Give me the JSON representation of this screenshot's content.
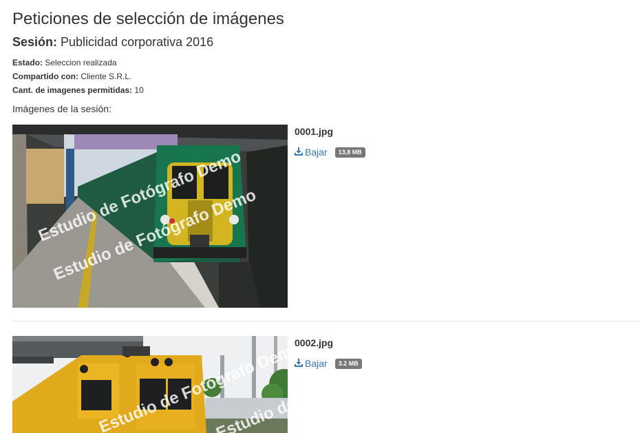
{
  "page": {
    "title": "Peticiones de selección de imágenes"
  },
  "session": {
    "label": "Sesión:",
    "name": "Publicidad corporativa 2016"
  },
  "meta": {
    "status_label": "Estado:",
    "status_value": "Seleccion realizada",
    "shared_label": "Compartido con:",
    "shared_value": "Cliente S.R.L.",
    "count_label": "Cant. de imagenes permitidas:",
    "count_value": "10"
  },
  "images_label": "Imágenes de la sesión:",
  "images": [
    {
      "filename": "0001.jpg",
      "download_label": "Bajar",
      "size": "13,8 MB",
      "watermark": "Estudio de Fotógrafo Demo"
    },
    {
      "filename": "0002.jpg",
      "download_label": "Bajar",
      "size": "3.2 MB",
      "watermark": "Estudio de Fotógrafo Demo"
    }
  ],
  "colors": {
    "link": "#337ab7",
    "badge": "#777777",
    "separator": "#e5e5e5"
  },
  "icons": {
    "download": "download-icon"
  }
}
